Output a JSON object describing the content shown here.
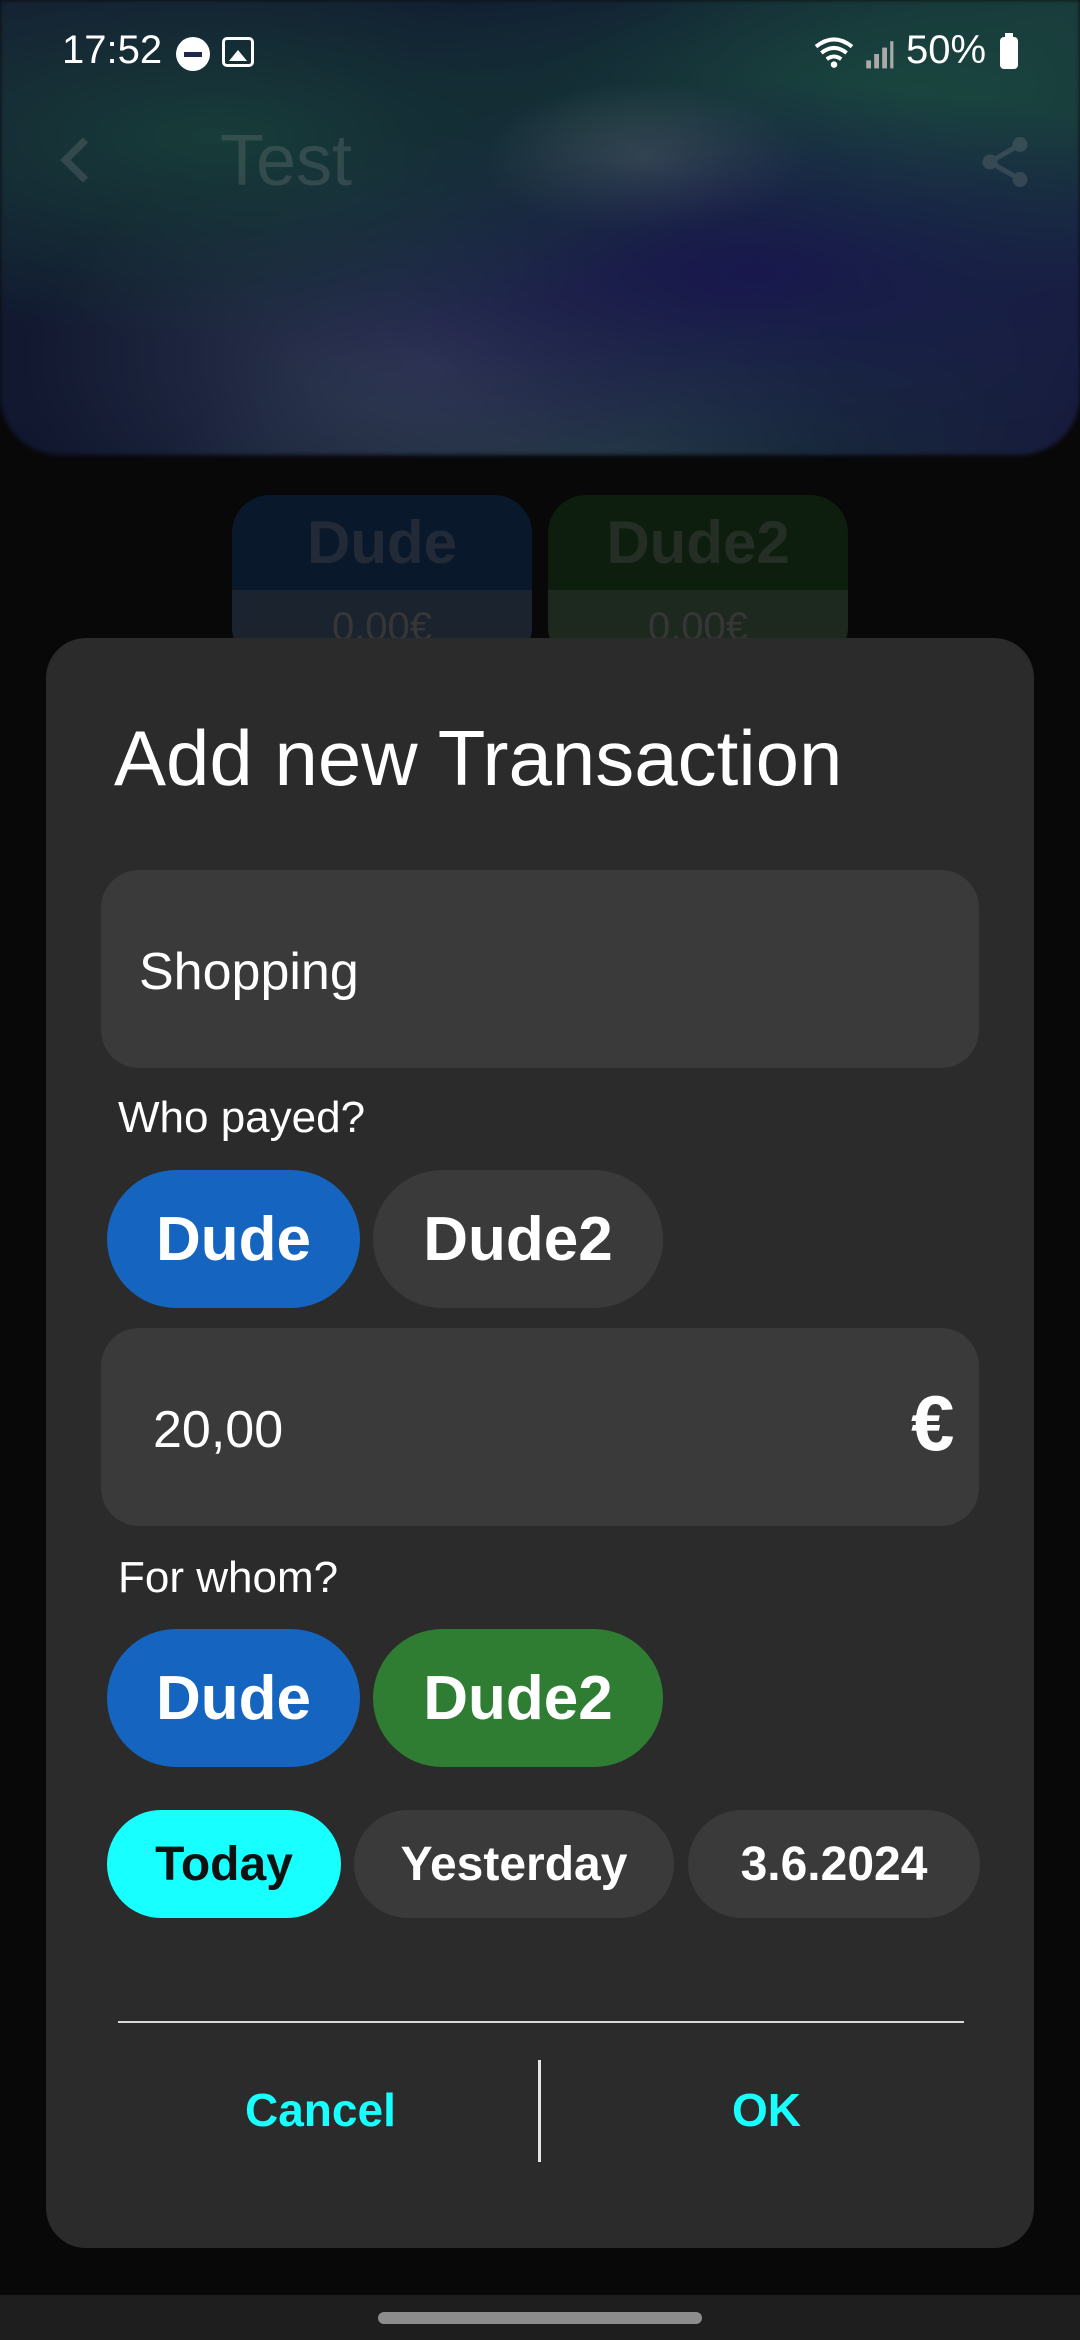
{
  "status_bar": {
    "time": "17:52",
    "battery": "50%"
  },
  "background": {
    "title": "Test",
    "members": [
      {
        "name": "Dude",
        "balance": "0,00€"
      },
      {
        "name": "Dude2",
        "balance": "0,00€"
      }
    ]
  },
  "dialog": {
    "title": "Add new Transaction",
    "description_value": "Shopping",
    "who_payed_label": "Who payed?",
    "payer_options": [
      "Dude",
      "Dude2"
    ],
    "selected_payer": "Dude",
    "amount_value": "20,00",
    "currency_symbol": "€",
    "for_whom_label": "For whom?",
    "recipient_options": [
      "Dude",
      "Dude2"
    ],
    "date_options": [
      "Today",
      "Yesterday",
      "3.6.2024"
    ],
    "selected_date": "Today",
    "cancel_label": "Cancel",
    "ok_label": "OK"
  },
  "colors": {
    "accent": "#18ffff",
    "member_blue": "#1565c0",
    "member_green": "#2e7d32",
    "dialog_bg": "#2b2b2b"
  }
}
